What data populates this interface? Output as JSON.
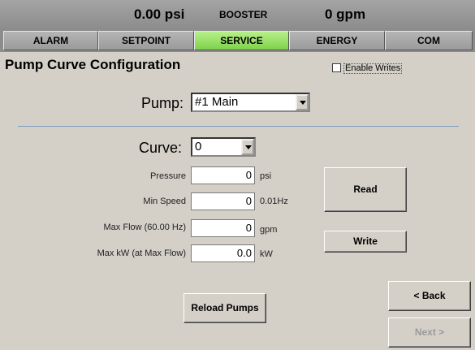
{
  "header": {
    "pressure": "0.00 psi",
    "mode": "BOOSTER",
    "flow": "0 gpm"
  },
  "tabs": [
    "ALARM",
    "SETPOINT",
    "SERVICE",
    "ENERGY",
    "COM"
  ],
  "active_tab": "SERVICE",
  "page_title": "Pump Curve Configuration",
  "enable_writes_label": "Enable Writes",
  "pump": {
    "label": "Pump:",
    "value": "#1 Main"
  },
  "curve": {
    "label": "Curve:",
    "value": "0"
  },
  "fields": {
    "pressure": {
      "label": "Pressure",
      "value": "0",
      "unit": "psi"
    },
    "min_speed": {
      "label": "Min Speed",
      "value": "0",
      "unit": "0.01Hz"
    },
    "max_flow": {
      "label": "Max Flow (60.00 Hz)",
      "value": "0",
      "unit": "gpm"
    },
    "max_kw": {
      "label": "Max kW (at Max Flow)",
      "value": "0.0",
      "unit": "kW"
    }
  },
  "buttons": {
    "read": "Read",
    "write": "Write",
    "reload": "Reload Pumps",
    "back": "< Back",
    "next": "Next >"
  }
}
